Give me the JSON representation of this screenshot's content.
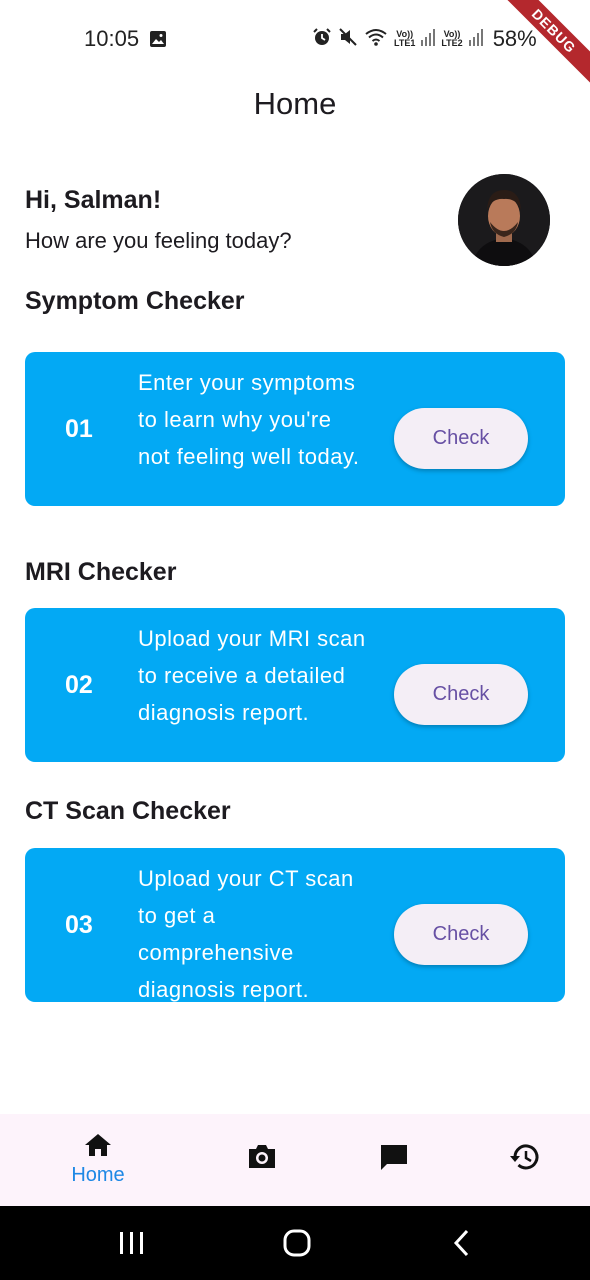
{
  "status_bar": {
    "time": "10:05",
    "battery": "58%",
    "sim1": "LTE1",
    "sim2": "LTE2",
    "volte": "Vo))"
  },
  "debug_banner": "DEBUG",
  "app_bar": {
    "title": "Home"
  },
  "greeting": {
    "hello": "Hi, Salman!",
    "question": "How are you feeling today?"
  },
  "sections": [
    {
      "title": "Symptom Checker",
      "number": "01",
      "description": "Enter your symptoms to learn why you're not feeling well today.",
      "button_label": "Check"
    },
    {
      "title": "MRI Checker",
      "number": "02",
      "description": "Upload your MRI scan to receive a detailed diagnosis report.",
      "button_label": "Check"
    },
    {
      "title": "CT Scan Checker",
      "number": "03",
      "description": "Upload your CT scan to get a comprehensive diagnosis report.",
      "button_label": "Check"
    }
  ],
  "bottom_nav": {
    "items": [
      {
        "label": "Home",
        "icon": "home-icon",
        "selected": true
      },
      {
        "label": "",
        "icon": "camera-icon",
        "selected": false
      },
      {
        "label": "",
        "icon": "chat-icon",
        "selected": false
      },
      {
        "label": "",
        "icon": "history-icon",
        "selected": false
      }
    ]
  },
  "colors": {
    "card": "#03a9f4",
    "button_bg": "#f4eef6",
    "button_text": "#6750a4",
    "nav_bg": "#fdf3fb",
    "nav_selected": "#1e88e5"
  }
}
